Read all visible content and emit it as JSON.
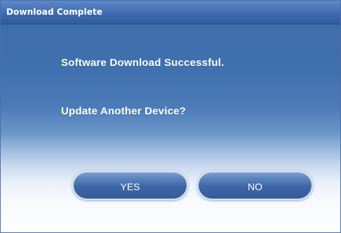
{
  "window": {
    "title": "Download Complete"
  },
  "messages": {
    "line1": "Software Download Successful.",
    "line2": "Update Another Device?"
  },
  "buttons": {
    "yes_label": "YES",
    "no_label": "NO"
  },
  "colors": {
    "titlebar": "#3f6bb1",
    "panel_top": "#3e6dab",
    "button": "#3f67a6",
    "text": "#ffffff"
  }
}
